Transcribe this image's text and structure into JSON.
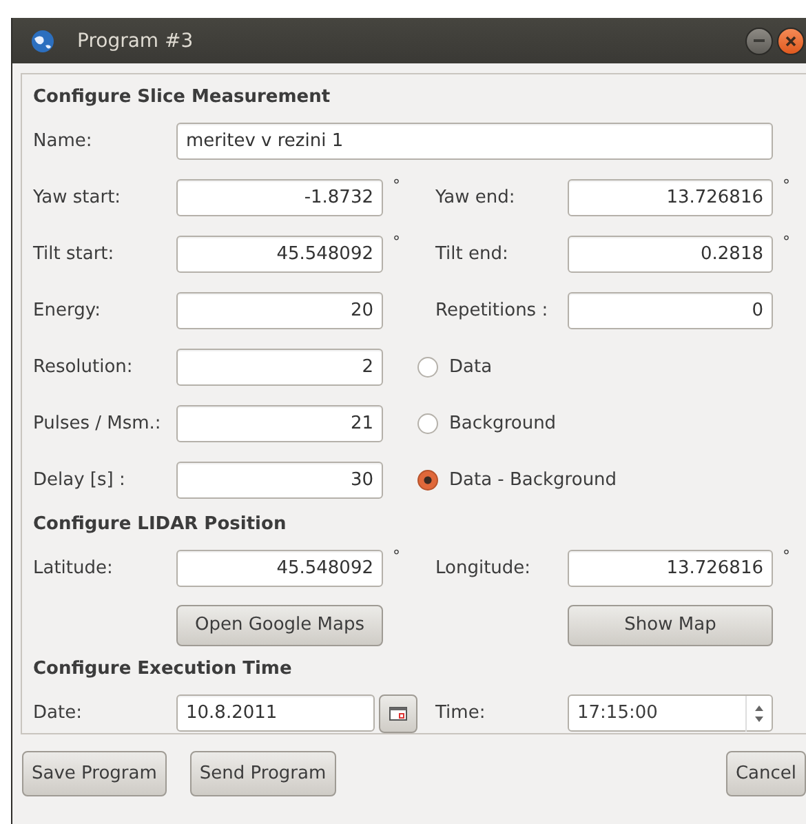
{
  "window": {
    "title": "Program #3"
  },
  "sections": [
    {
      "title": "Configure Slice Measurement",
      "rows": [
        {
          "kind": "wide",
          "label": "Name:",
          "value": "meritev v rezini 1"
        },
        {
          "kind": "pair",
          "left": {
            "kind": "field",
            "label": "Yaw start:",
            "value": "-1.8732",
            "unit": "°"
          },
          "right": {
            "kind": "field",
            "label": "Yaw end:",
            "value": "13.726816",
            "unit": "°"
          }
        },
        {
          "kind": "pair",
          "left": {
            "kind": "field",
            "label": "Tilt start:",
            "value": "45.548092",
            "unit": "°"
          },
          "right": {
            "kind": "field",
            "label": "Tilt end:",
            "value": "0.2818",
            "unit": "°"
          }
        },
        {
          "kind": "pair",
          "left": {
            "kind": "field",
            "label": "Energy:",
            "value": "20"
          },
          "right": {
            "kind": "field",
            "label": "Repetitions :",
            "value": "0"
          }
        },
        {
          "kind": "pair",
          "left": {
            "kind": "field",
            "label": "Resolution:",
            "value": "2"
          },
          "right": {
            "kind": "radio",
            "label": "Data",
            "selected": false
          }
        },
        {
          "kind": "pair",
          "left": {
            "kind": "field",
            "label": "Pulses / Msm.:",
            "value": "21"
          },
          "right": {
            "kind": "radio",
            "label": "Background",
            "selected": false
          }
        },
        {
          "kind": "pair",
          "left": {
            "kind": "field",
            "label": "Delay [s] :",
            "value": "30"
          },
          "right": {
            "kind": "radio",
            "label": "Data - Background",
            "selected": true
          }
        }
      ]
    },
    {
      "title": "Configure LIDAR Position",
      "rows": [
        {
          "kind": "pair",
          "left": {
            "kind": "field",
            "label": "Latitude:",
            "value": "45.548092",
            "unit": "°"
          },
          "right": {
            "kind": "field",
            "label": "Longitude:",
            "value": "13.726816",
            "unit": "°"
          }
        },
        {
          "kind": "pair",
          "left": {
            "kind": "button",
            "label": "Open Google Maps"
          },
          "right": {
            "kind": "button",
            "label": "Show Map"
          }
        }
      ]
    },
    {
      "title": "Configure Execution Time",
      "rows": [
        {
          "kind": "pair",
          "left": {
            "kind": "date",
            "label": "Date:",
            "value": "10.8.2011"
          },
          "right": {
            "kind": "time",
            "label": "Time:",
            "value": "17:15:00"
          }
        }
      ]
    }
  ],
  "buttons_left": [
    {
      "label": "Save Program"
    },
    {
      "label": "Send Program"
    }
  ],
  "buttons_right": [
    {
      "label": "Cancel"
    }
  ]
}
